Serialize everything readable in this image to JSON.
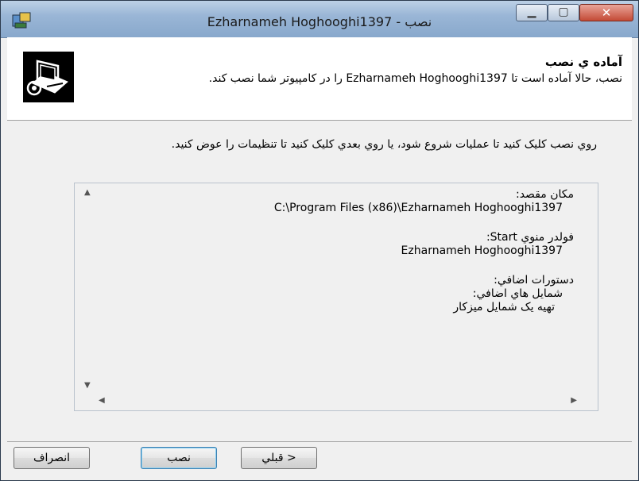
{
  "window": {
    "title": "Ezharnameh Hoghooghi1397 - نصب"
  },
  "header": {
    "title": "آماده ي نصب",
    "subtitle": "نصب، حالا آماده است تا Ezharnameh Hoghooghi1397 را در كامپيوتر شما نصب كند."
  },
  "instruction": "روي نصب كليک كنيد تا عمليات شروع شود، يا روي بعدي كليک كنيد تا تنظيمات را عوض كنيد.",
  "memo": {
    "dest_label": "مكان مقصد:",
    "dest_value": "C:\\Program Files (x86)\\Ezharnameh Hoghooghi1397",
    "start_label": "فولدر منوي Start:",
    "start_value": "Ezharnameh Hoghooghi1397",
    "tasks_label": "دستورات اضافي:",
    "tasks_group": "شمايل هاي اضافي:",
    "tasks_item": "تهيه يک شمايل ميزكار"
  },
  "buttons": {
    "back": "< قبلي",
    "install": "نصب",
    "cancel": "انصراف"
  }
}
